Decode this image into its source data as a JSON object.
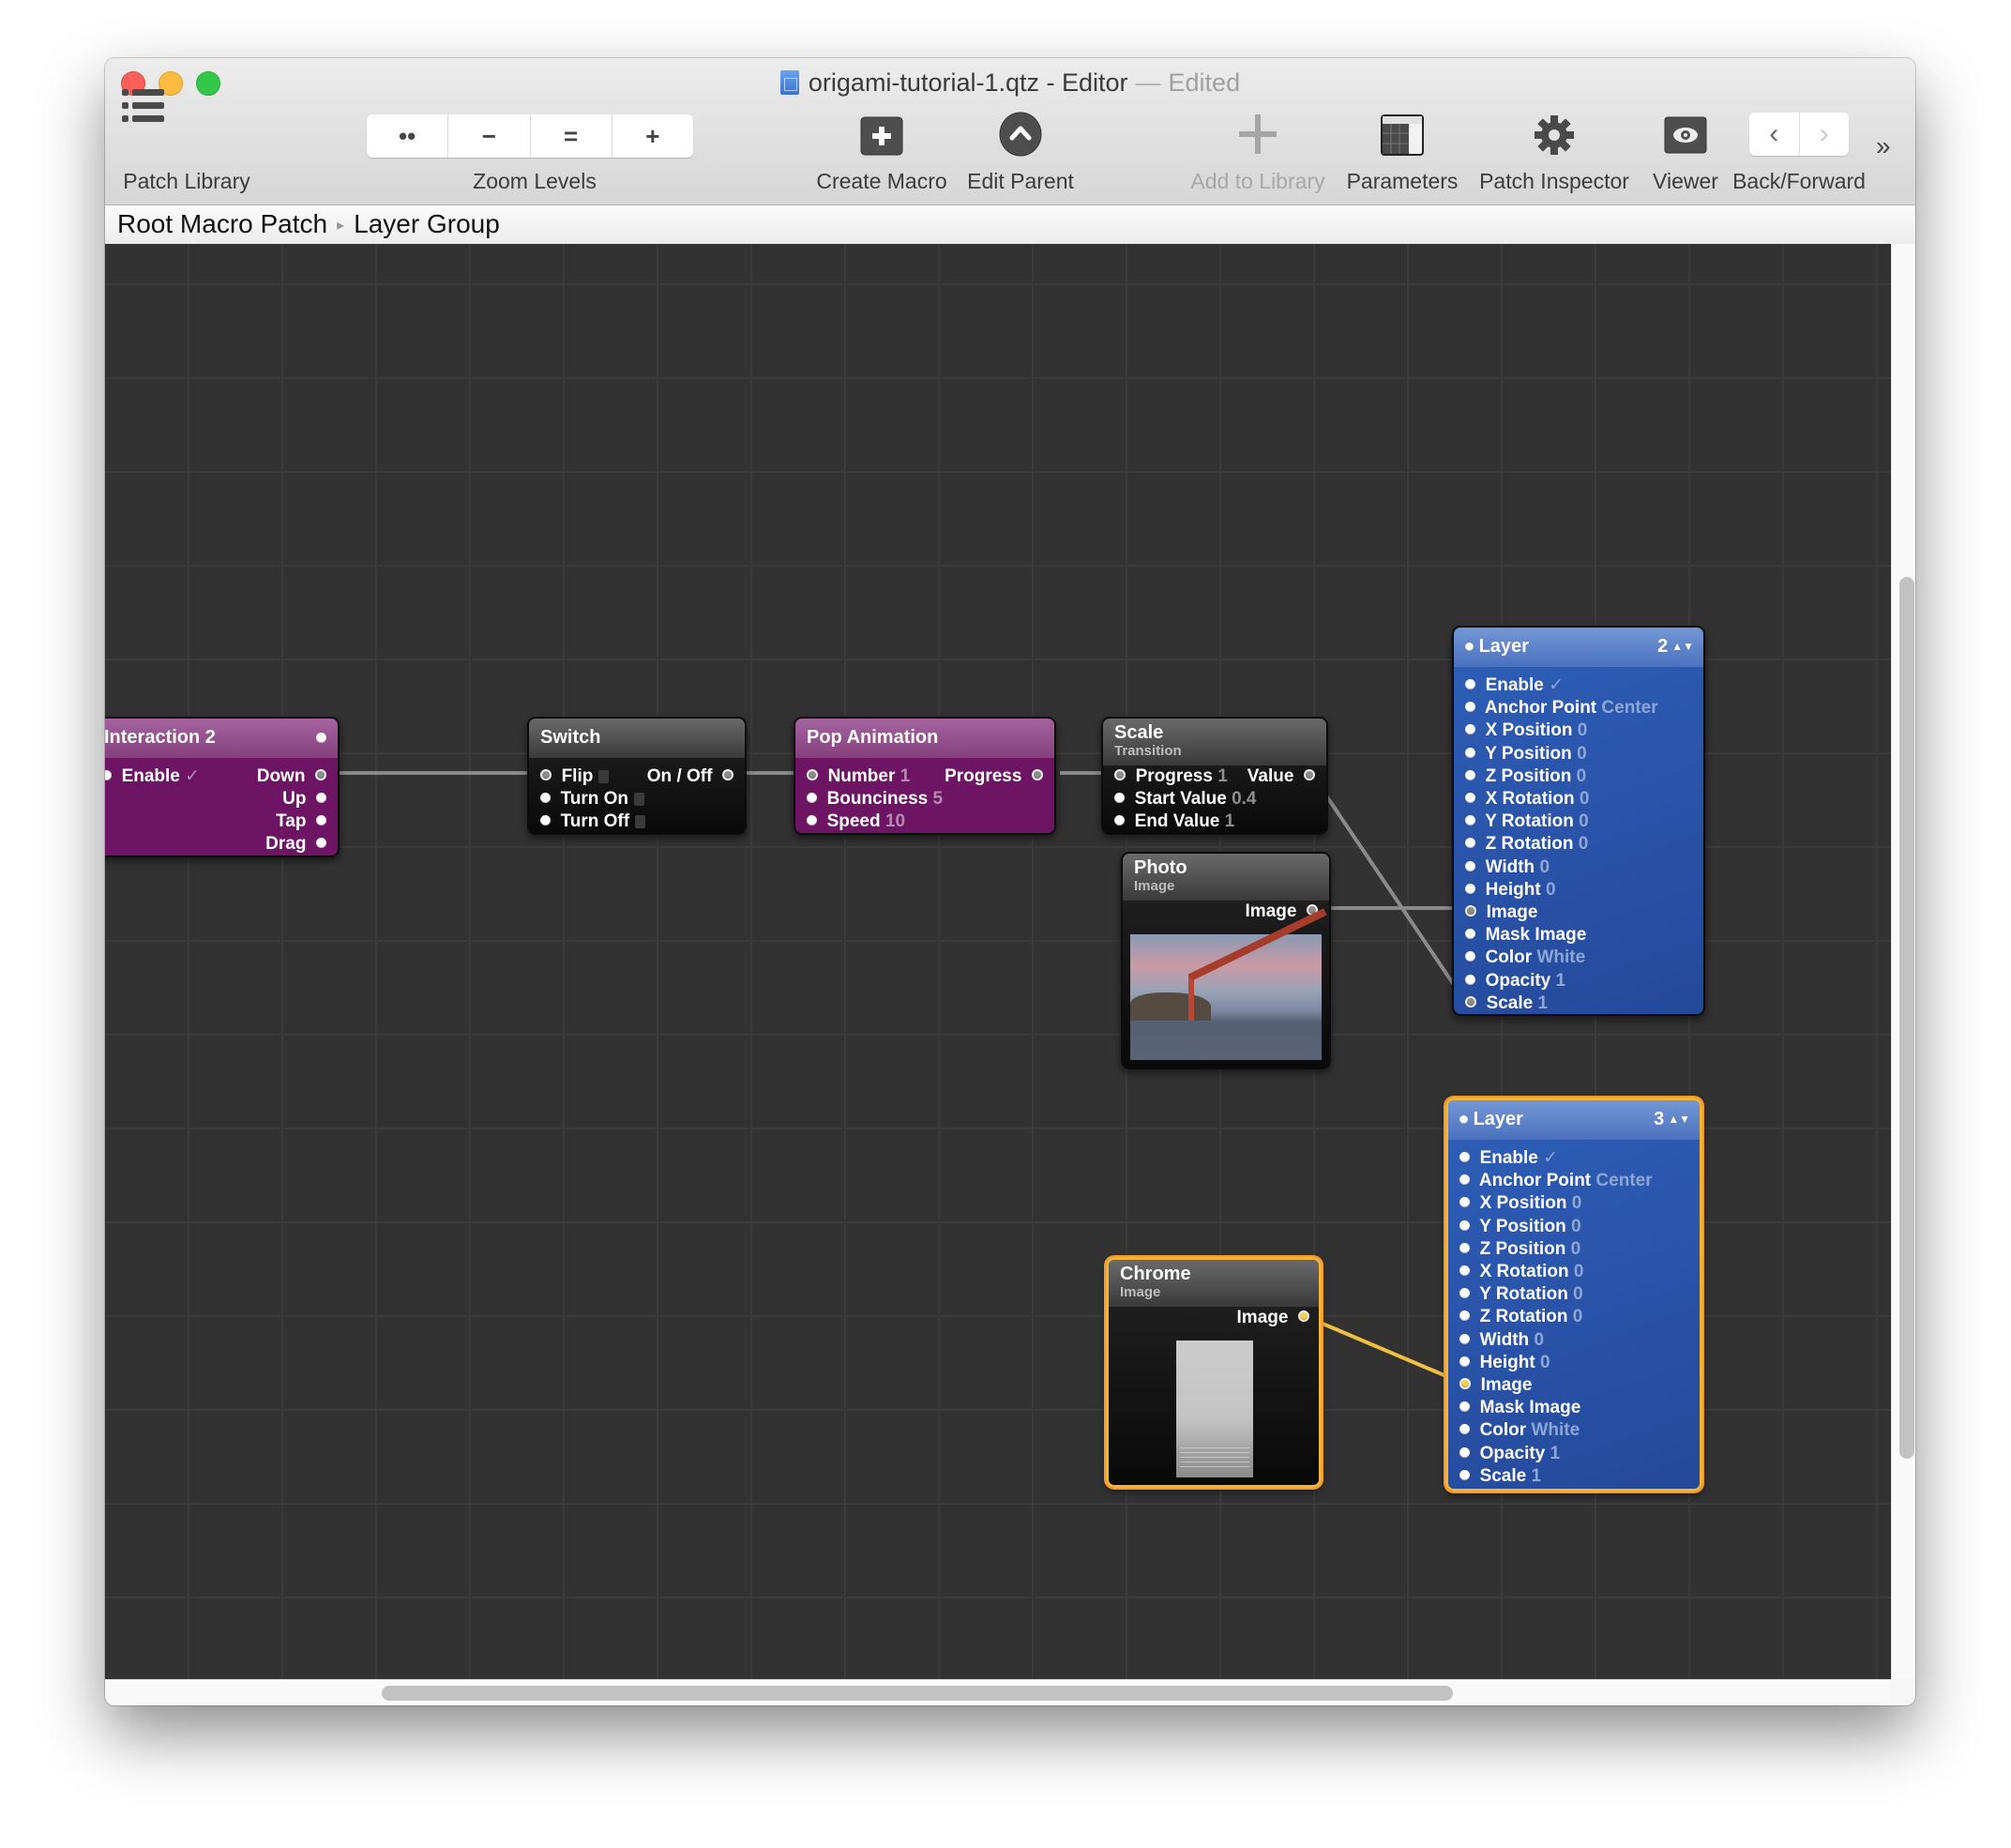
{
  "window": {
    "title": "origami-tutorial-1.qtz - Editor",
    "title_separator": "—",
    "title_status": "Edited"
  },
  "toolbar": {
    "patch_library": "Patch Library",
    "zoom_levels": "Zoom Levels",
    "zoom_buttons": [
      "••",
      "−",
      "=",
      "+"
    ],
    "create_macro": "Create Macro",
    "edit_parent": "Edit Parent",
    "add_to_library": "Add to Library",
    "parameters": "Parameters",
    "patch_inspector": "Patch Inspector",
    "viewer": "Viewer",
    "back_forward": "Back/Forward",
    "back_glyph": "‹",
    "forward_glyph": "›",
    "overflow_glyph": "»"
  },
  "breadcrumb": {
    "items": [
      "Root Macro Patch",
      "Layer Group"
    ],
    "separator": "▸"
  },
  "nodes": {
    "interaction": {
      "title": "Interaction 2",
      "inputs": [
        {
          "label": "Enable",
          "value": "✓"
        }
      ],
      "outputs": [
        "Down",
        "Up",
        "Tap",
        "Drag"
      ]
    },
    "switch": {
      "title": "Switch",
      "inputs": [
        "Flip",
        "Turn On",
        "Turn Off"
      ],
      "outputs": [
        "On / Off"
      ]
    },
    "pop_animation": {
      "title": "Pop Animation",
      "inputs": [
        {
          "label": "Number",
          "value": "1"
        },
        {
          "label": "Bounciness",
          "value": "5"
        },
        {
          "label": "Speed",
          "value": "10"
        }
      ],
      "outputs": [
        "Progress"
      ]
    },
    "scale": {
      "title": "Scale",
      "subtitle": "Transition",
      "inputs": [
        {
          "label": "Progress",
          "value": "1"
        },
        {
          "label": "Start Value",
          "value": "0.4"
        },
        {
          "label": "End Value",
          "value": "1"
        }
      ],
      "outputs": [
        "Value"
      ]
    },
    "photo": {
      "title": "Photo",
      "subtitle": "Image",
      "outputs": [
        "Image"
      ]
    },
    "chrome": {
      "title": "Chrome",
      "subtitle": "Image",
      "outputs": [
        "Image"
      ]
    },
    "layer2": {
      "title": "Layer",
      "index": "2",
      "inputs": [
        {
          "label": "Enable",
          "value": "✓"
        },
        {
          "label": "Anchor Point",
          "value": "Center"
        },
        {
          "label": "X Position",
          "value": "0"
        },
        {
          "label": "Y Position",
          "value": "0"
        },
        {
          "label": "Z Position",
          "value": "0"
        },
        {
          "label": "X Rotation",
          "value": "0"
        },
        {
          "label": "Y Rotation",
          "value": "0"
        },
        {
          "label": "Z Rotation",
          "value": "0"
        },
        {
          "label": "Width",
          "value": "0"
        },
        {
          "label": "Height",
          "value": "0"
        },
        {
          "label": "Image",
          "value": ""
        },
        {
          "label": "Mask Image",
          "value": ""
        },
        {
          "label": "Color",
          "value": "White"
        },
        {
          "label": "Opacity",
          "value": "1"
        },
        {
          "label": "Scale",
          "value": "1"
        }
      ]
    },
    "layer3": {
      "title": "Layer",
      "index": "3",
      "inputs": [
        {
          "label": "Enable",
          "value": "✓"
        },
        {
          "label": "Anchor Point",
          "value": "Center"
        },
        {
          "label": "X Position",
          "value": "0"
        },
        {
          "label": "Y Position",
          "value": "0"
        },
        {
          "label": "Z Position",
          "value": "0"
        },
        {
          "label": "X Rotation",
          "value": "0"
        },
        {
          "label": "Y Rotation",
          "value": "0"
        },
        {
          "label": "Z Rotation",
          "value": "0"
        },
        {
          "label": "Width",
          "value": "0"
        },
        {
          "label": "Height",
          "value": "0"
        },
        {
          "label": "Image",
          "value": ""
        },
        {
          "label": "Mask Image",
          "value": ""
        },
        {
          "label": "Color",
          "value": "White"
        },
        {
          "label": "Opacity",
          "value": "1"
        },
        {
          "label": "Scale",
          "value": "1"
        }
      ]
    }
  },
  "colors": {
    "canvas": "#323232",
    "macro_purple": "#6e1465",
    "layer_blue": "#2a55ac",
    "selection": "#f4b43a",
    "wire": "#8a8a8a",
    "wire_selected": "#f0c040"
  }
}
